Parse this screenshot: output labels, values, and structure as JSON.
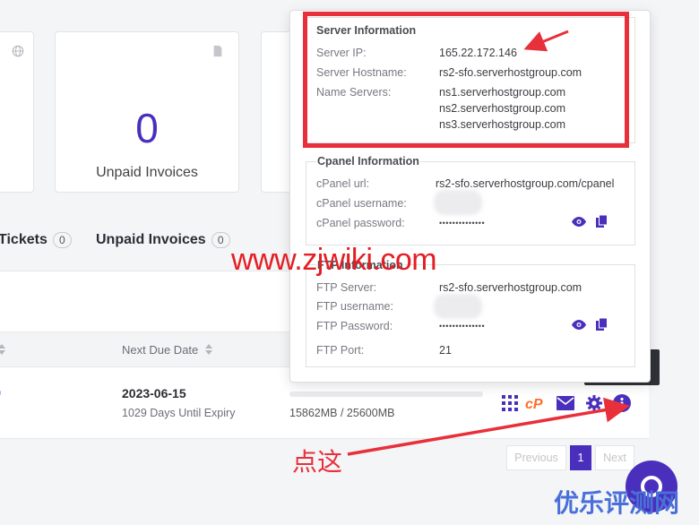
{
  "stats": [
    {
      "icon": "globe-icon"
    },
    {
      "value": "0",
      "label": "Unpaid Invoices",
      "icon": "document-icon"
    },
    {}
  ],
  "tabs": [
    {
      "label": "Tickets",
      "count": "0"
    },
    {
      "label": "Unpaid Invoices",
      "count": "0"
    }
  ],
  "table": {
    "headers": [
      "Next Due Date"
    ],
    "row": {
      "due_date": "2023-06-15",
      "expiry": "1029 Days Until Expiry",
      "disk_usage": "15862MB / 25600MB",
      "disk_fraction": 0.62
    }
  },
  "server_info": {
    "title": "Server Information",
    "ip_label": "Server IP:",
    "ip": "165.22.172.146",
    "hostname_label": "Server Hostname:",
    "hostname": "rs2-sfo.serverhostgroup.com",
    "ns_label": "Name Servers:",
    "nameservers": [
      "ns1.serverhostgroup.com",
      "ns2.serverhostgroup.com",
      "ns3.serverhostgroup.com"
    ]
  },
  "cpanel": {
    "title": "Cpanel Information",
    "url_label": "cPanel url:",
    "url": "rs2-sfo.serverhostgroup.com/cpanel",
    "user_label": "cPanel username:",
    "pass_label": "cPanel password:",
    "pass_mask": "••••••••••••••"
  },
  "ftp": {
    "title": "FTP Information",
    "server_label": "FTP Server:",
    "server": "rs2-sfo.serverhostgroup.com",
    "user_label": "FTP username:",
    "pass_label": "FTP Password:",
    "pass_mask": "••••••••••••••",
    "port_label": "FTP Port:",
    "port": "21"
  },
  "actions": [
    "grid-icon",
    "cpanel-icon",
    "mail-icon",
    "gear-icon",
    "info-icon"
  ],
  "pagination": {
    "prev": "Previous",
    "page": "1",
    "next": "Next"
  },
  "annotations": {
    "watermark": "www.zjwiki.com",
    "click_here": "点这",
    "brand_watermark": "优乐评测网"
  },
  "colors": {
    "accent": "#4a2fbd",
    "annotation_red": "#e8303a"
  }
}
